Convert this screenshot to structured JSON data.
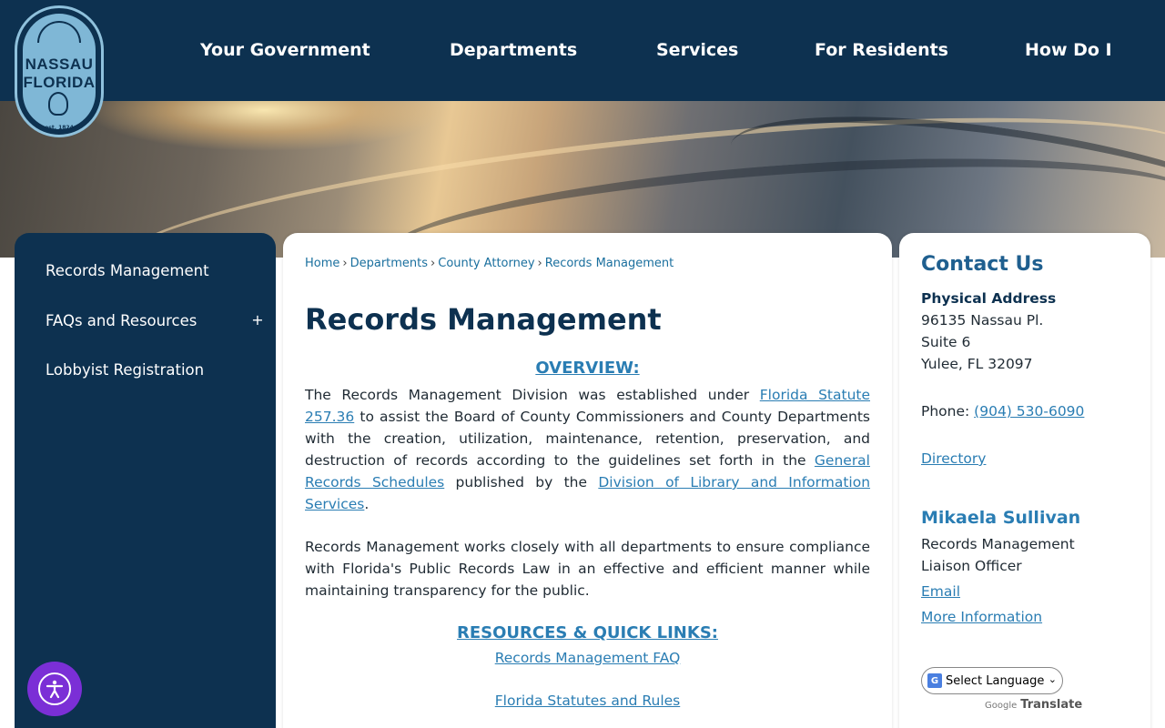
{
  "logo": {
    "line1": "NASSAU",
    "line2": "FLORIDA",
    "est": "est. 1824"
  },
  "nav": {
    "items": [
      "Your Government",
      "Departments",
      "Services",
      "For Residents",
      "How Do I"
    ]
  },
  "sidebar": {
    "items": [
      {
        "label": "Records Management"
      },
      {
        "label": "FAQs and Resources",
        "toggle": "+"
      },
      {
        "label": "Lobbyist Registration"
      }
    ]
  },
  "breadcrumb": {
    "items": [
      "Home",
      "Departments",
      "County Attorney",
      "Records Management"
    ],
    "separator": "›"
  },
  "main": {
    "title": "Records Management",
    "overview_heading": "OVERVIEW:",
    "p1": {
      "t1": "The Records Management Division was established under ",
      "l1": "Florida Statute 257.36",
      "t2": " to assist the Board of County Commissioners and County Departments with the creation, utilization, maintenance, retention, preservation, and destruction of records according to the guidelines set forth in the ",
      "l2": "General Records Schedules",
      "t3": " published by the ",
      "l3": "Division of Library and Information Services",
      "t4": "."
    },
    "p2": "Records Management works closely with all departments to ensure compliance with Florida's Public Records Law in an effective and efficient manner while maintaining transparency for the public.",
    "resources_heading": "RESOURCES & QUICK LINKS:",
    "links": [
      "Records Management FAQ",
      "Florida Statutes and Rules"
    ]
  },
  "contact": {
    "title": "Contact Us",
    "address_label": "Physical Address",
    "address": [
      "96135 Nassau Pl.",
      "Suite 6",
      "Yulee, FL 32097"
    ],
    "phone_label": "Phone: ",
    "phone": "(904) 530-6090",
    "directory": "Directory",
    "person_name": "Mikaela Sullivan",
    "person_title": [
      "Records Management",
      "Liaison Officer"
    ],
    "email": "Email",
    "more_info": "More Information"
  },
  "translate": {
    "select_label": "Select Language",
    "google": "Google",
    "translate": "Translate"
  },
  "colors": {
    "navy": "#0d3150",
    "link": "#2a7db3",
    "accessibility": "#7b2fd6"
  }
}
